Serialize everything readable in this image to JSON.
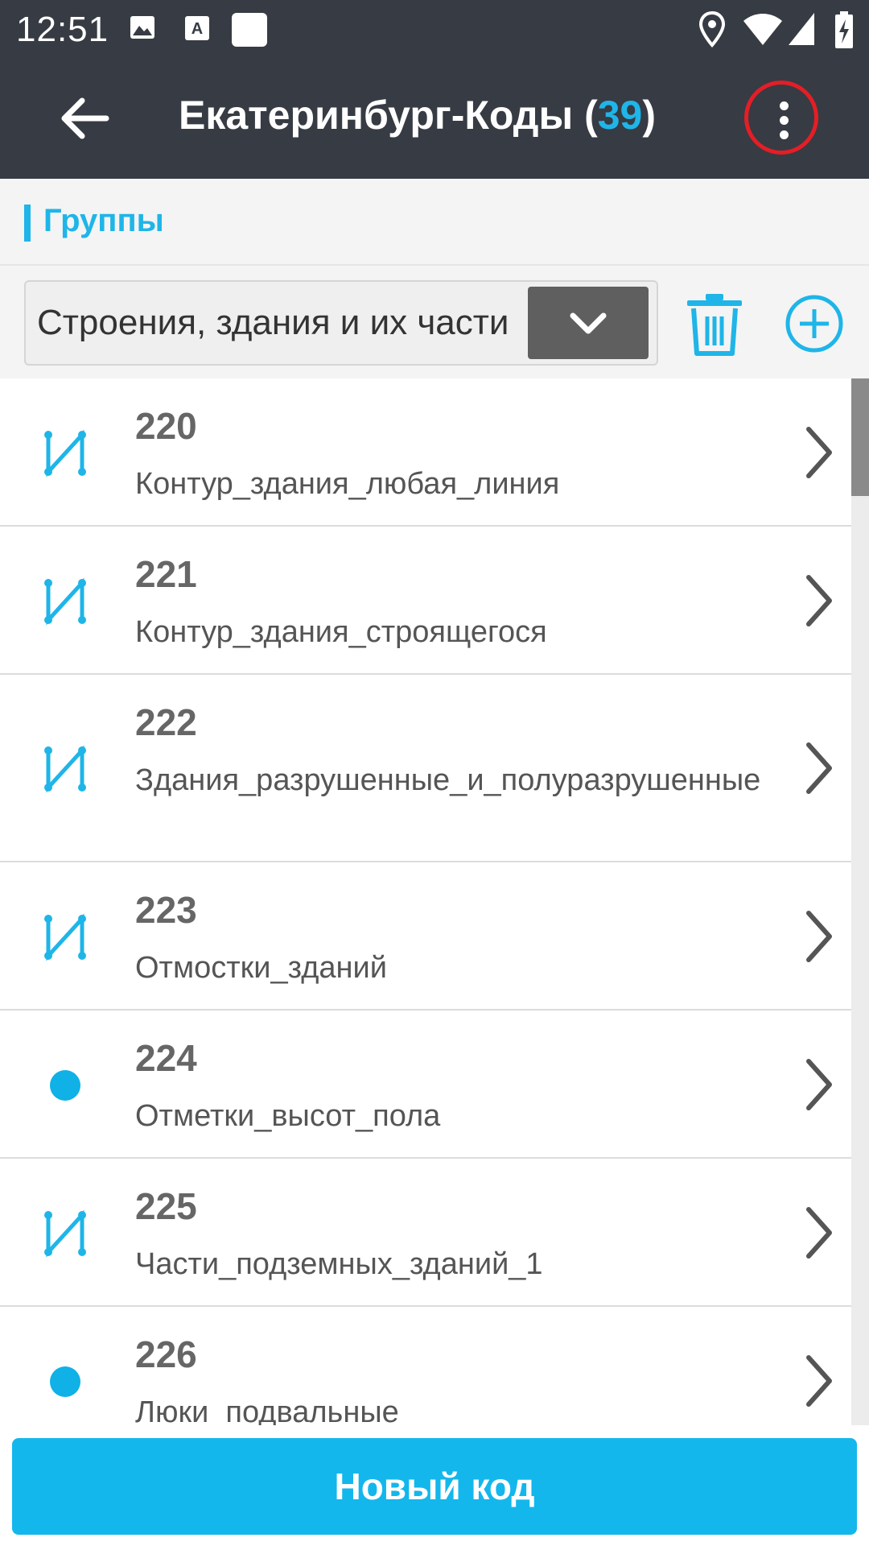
{
  "status_bar": {
    "time": "12:51",
    "icons": [
      "image-icon",
      "a-font-icon",
      "square-notification-icon",
      "location-icon",
      "wifi-icon",
      "signal-icon",
      "battery-charging-icon"
    ]
  },
  "app_bar": {
    "title_prefix": "Екатеринбург-Коды (",
    "count": "39",
    "title_suffix": ")",
    "back_icon": "arrow-left-icon",
    "menu_icon": "more-vert-icon"
  },
  "group_section": {
    "label": "Группы",
    "selected_group": "Строения, здания и их части",
    "dropdown_icon": "chevron-down-icon",
    "delete_icon": "trash-icon",
    "add_icon": "plus-circle-icon"
  },
  "codes": [
    {
      "code": "220",
      "name": "Контур_здания_любая_линия",
      "type": "line"
    },
    {
      "code": "221",
      "name": "Контур_здания_строящегося",
      "type": "line"
    },
    {
      "code": "222",
      "name": "Здания_разрушенные_и_полуразрушенные",
      "type": "line"
    },
    {
      "code": "223",
      "name": "Отмостки_зданий",
      "type": "line"
    },
    {
      "code": "224",
      "name": "Отметки_высот_пола",
      "type": "point"
    },
    {
      "code": "225",
      "name": "Части_подземных_зданий_1",
      "type": "line"
    },
    {
      "code": "226",
      "name": "Люки_подвальные",
      "type": "point"
    }
  ],
  "new_code_button": "Новый код",
  "colors": {
    "accent": "#1fb5e8",
    "app_bar": "#373b43",
    "button": "#13b7ec",
    "highlight_ring": "#e41e26"
  }
}
